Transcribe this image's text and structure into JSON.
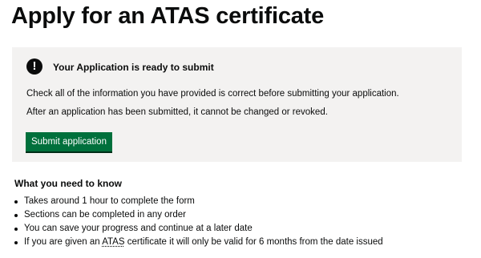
{
  "page": {
    "title": "Apply for an ATAS certificate"
  },
  "notice": {
    "icon": "exclamation-icon",
    "icon_glyph": "!",
    "heading": "Your Application is ready to submit",
    "paragraphs": [
      "Check all of the information you have provided is correct before submitting your application.",
      "After an application has been submitted, it cannot be changed or revoked."
    ],
    "submit_label": "Submit application",
    "button_color": "#00703c",
    "panel_color": "#f3f2f1"
  },
  "info": {
    "heading": "What you need to know",
    "items": [
      "Takes around 1 hour to complete the form",
      "Sections can be completed in any order",
      "You can save your progress and continue at a later date"
    ],
    "last_item": {
      "before": "If you are given an ",
      "abbr": "ATAS",
      "after": " certificate it will only be valid for 6 months from the date issued"
    }
  }
}
